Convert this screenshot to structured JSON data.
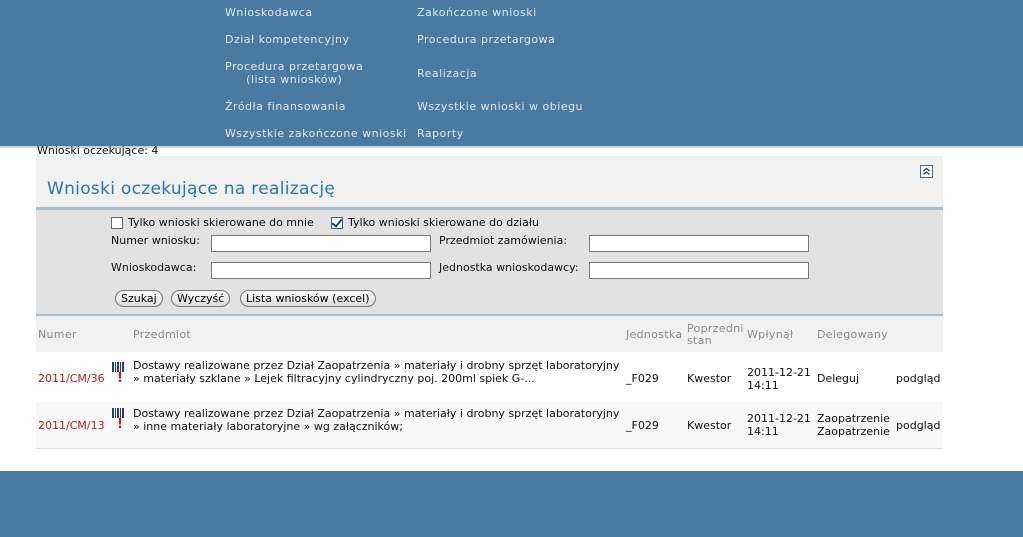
{
  "nav": {
    "left": [
      {
        "label": "Wnioskodawca"
      },
      {
        "label": "Dział kompetencyjny"
      },
      {
        "label_line1": "Procedura przetargowa",
        "label_line2": "(lista wniosków)"
      },
      {
        "label": "Źródła finansowania"
      },
      {
        "label": "Wszystkie zakończone wnioski"
      }
    ],
    "right": [
      {
        "label": "Zakończone wnioski"
      },
      {
        "label": "Procedura przetargowa"
      },
      {
        "label": "Realizacja"
      },
      {
        "label": "Wszystkie wnioski w obiegu"
      },
      {
        "label": "Raporty"
      }
    ]
  },
  "pending_count": "Wnioski oczekujące: 4",
  "panel": {
    "title": "Wnioski oczekujące na realizację",
    "filter": {
      "cb_mine_label": "Tylko wnioski skierowane do mnie",
      "cb_mine_checked": false,
      "cb_dept_label": "Tylko wnioski skierowane do działu",
      "cb_dept_checked": true,
      "number_label": "Numer wniosku:",
      "number_value": "",
      "subject_label": "Przedmiot zamówienia:",
      "subject_value": "",
      "applicant_label": "Wnioskodawca:",
      "applicant_value": "",
      "unit_label": "Jednostka wnioskodawcy:",
      "unit_value": "",
      "search_button": "Szukaj",
      "clear_button": "Wyczyść",
      "excel_button": "Lista wniosków (excel)"
    },
    "table": {
      "headers": {
        "number": "Numer",
        "subject": "Przedmiot",
        "unit": "Jednostka",
        "prev_state_1": "Poprzedni",
        "prev_state_2": "stan",
        "received": "Wpłynął",
        "delegated": "Delegowany"
      },
      "rows": [
        {
          "number": "2011/CM/36",
          "subject": "Dostawy realizowane przez Dział Zaopatrzenia » materiały i drobny sprzęt laboratoryjny » materiały szklane » Lejek filtracyjny cylindryczny poj. 200ml spiek G-...",
          "unit": "_F029",
          "prev_state": "Kwestor",
          "received_date": "2011-12-21",
          "received_time": "14:11",
          "delegated_1": "Deleguj",
          "delegated_2": "",
          "action": "podgląd"
        },
        {
          "number": "2011/CM/13",
          "subject": "Dostawy realizowane przez Dział Zaopatrzenia » materiały i drobny sprzęt laboratoryjny » inne materiały laboratoryjne » wg załączników;",
          "unit": "_F029",
          "prev_state": "Kwestor",
          "received_date": "2011-12-21",
          "received_time": "14:11",
          "delegated_1": "Zaopatrzenie",
          "delegated_2": "Zaopatrzenie",
          "action": "podgląd"
        }
      ]
    }
  }
}
